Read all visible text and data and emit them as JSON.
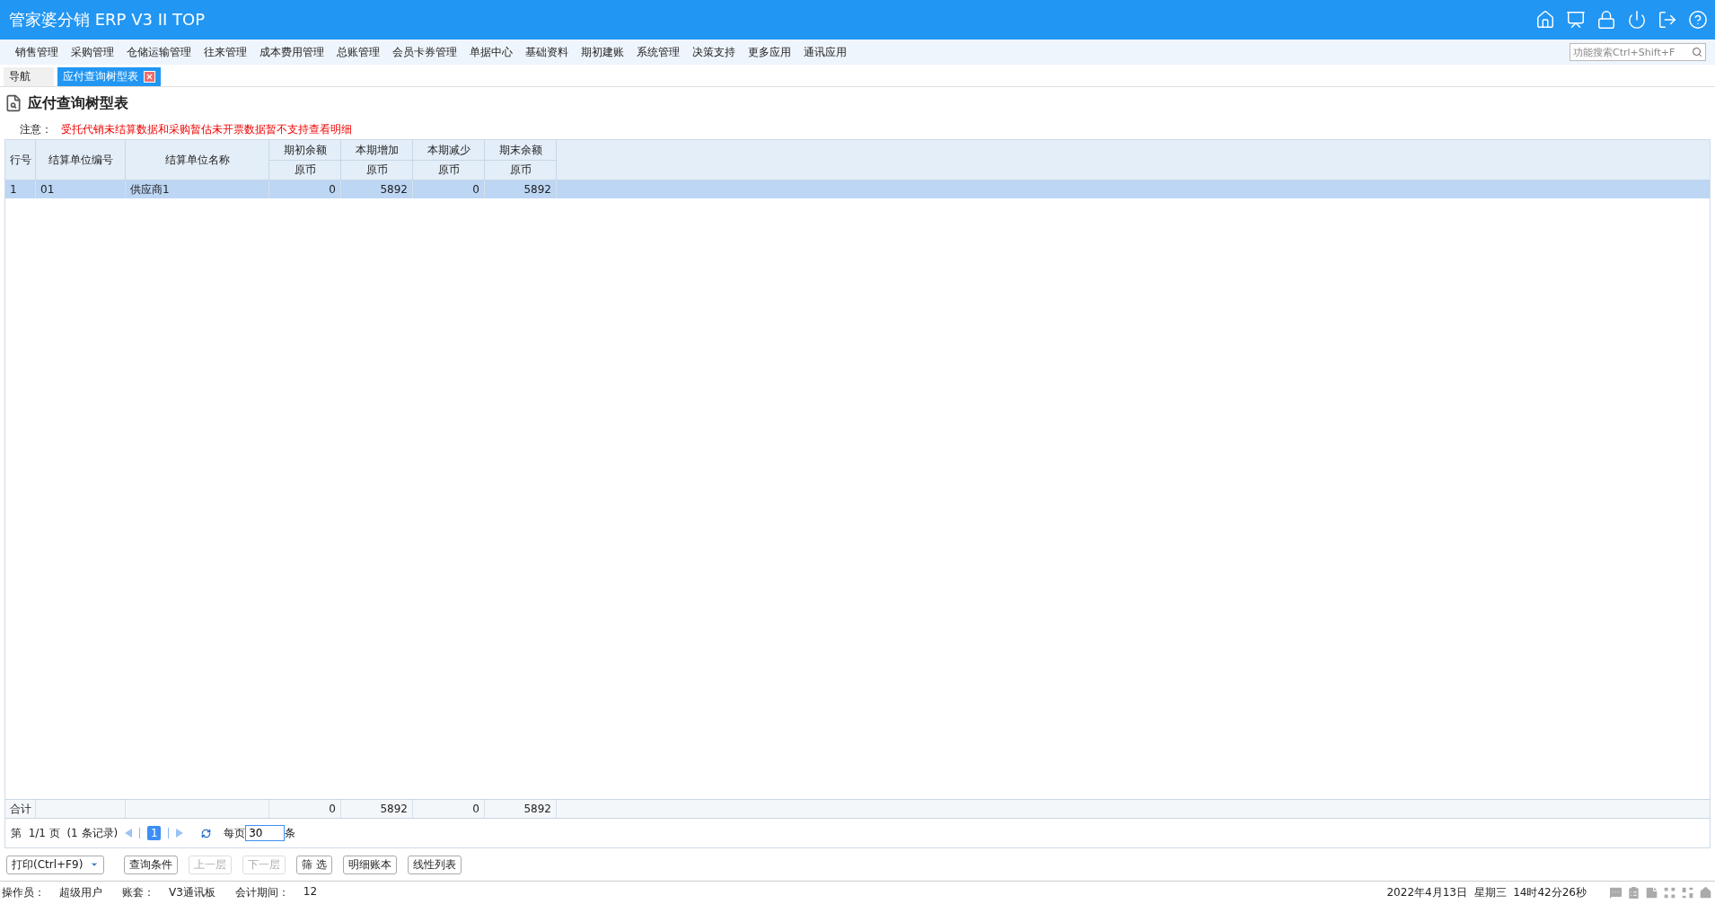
{
  "app_title": "管家婆分销 ERP V3 II TOP",
  "menu": [
    "销售管理",
    "采购管理",
    "仓储运输管理",
    "往来管理",
    "成本费用管理",
    "总账管理",
    "会员卡券管理",
    "单据中心",
    "基础资料",
    "期初建账",
    "系统管理",
    "决策支持",
    "更多应用",
    "通讯应用"
  ],
  "search": {
    "placeholder": "功能搜索Ctrl+Shift+F"
  },
  "tabs": [
    {
      "label": "导航",
      "selected": false,
      "closable": false
    },
    {
      "label": "应付查询树型表",
      "selected": true,
      "closable": true
    }
  ],
  "page_title": "应付查询树型表",
  "notice": {
    "label": "注意：",
    "text": "受托代销未结算数据和采购暂估未开票数据暂不支持查看明细"
  },
  "table": {
    "columns": [
      {
        "label": "行号"
      },
      {
        "label": "结算单位编号"
      },
      {
        "label": "结算单位名称"
      },
      {
        "label": "期初余额",
        "sub": "原币"
      },
      {
        "label": "本期增加",
        "sub": "原币"
      },
      {
        "label": "本期减少",
        "sub": "原币"
      },
      {
        "label": "期末余额",
        "sub": "原币"
      }
    ],
    "rows": [
      {
        "cells": [
          "1",
          "01",
          "供应商1",
          "0",
          "5892",
          "0",
          "5892"
        ],
        "selected": true
      }
    ],
    "totals": {
      "label": "合计",
      "values": [
        "0",
        "5892",
        "0",
        "5892"
      ]
    }
  },
  "pagination": {
    "summary": "第  1/1 页  (1 条记录)",
    "pages": [
      {
        "label": "1",
        "selected": true
      }
    ],
    "per_page_label": "每页",
    "per_page": "30",
    "unit": "条"
  },
  "toolbar": [
    {
      "label": "打印(Ctrl+F9)",
      "kind": "dropdown",
      "disabled": false
    },
    {
      "label": "查询条件",
      "kind": "button",
      "disabled": false
    },
    {
      "label": "上一层",
      "kind": "button",
      "disabled": true
    },
    {
      "label": "下一层",
      "kind": "button",
      "disabled": true
    },
    {
      "label": "筛 选",
      "kind": "button",
      "disabled": false
    },
    {
      "label": "明细账本",
      "kind": "button",
      "disabled": false
    },
    {
      "label": "线性列表",
      "kind": "button",
      "disabled": false
    }
  ],
  "status": [
    {
      "label": "操作员：",
      "value": "超级用户"
    },
    {
      "label": "账套：",
      "value": "V3通讯板"
    },
    {
      "label": "会计期间：",
      "value": "12"
    }
  ],
  "datetime": "2022年4月13日  星期三  14时42分26秒"
}
